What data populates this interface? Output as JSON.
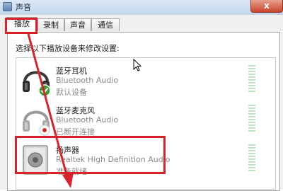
{
  "window": {
    "title": "声音",
    "close_glyph": "x"
  },
  "tabs": [
    {
      "label": "播放",
      "active": true
    },
    {
      "label": "录制",
      "active": false
    },
    {
      "label": "声音",
      "active": false
    },
    {
      "label": "通信",
      "active": false
    }
  ],
  "instruction": "选择以下播放设备来修改设置:",
  "devices": [
    {
      "name": "蓝牙耳机",
      "description": "Bluetooth Audio",
      "status": "默认设备",
      "icon": "headphones-icon",
      "badge": "green-check-badge"
    },
    {
      "name": "蓝牙麦克风",
      "description": "Bluetooth Audio",
      "status": "已断开连接",
      "icon": "headphones-icon",
      "badge": "red-disconnected-badge"
    },
    {
      "name": "扬声器",
      "description": "Realtek High Definition Audio",
      "status": "准备就绪",
      "icon": "speaker-icon",
      "badge": ""
    }
  ],
  "colors": {
    "highlight": "#d8232a",
    "meter": "#bfe3c0",
    "check": "#2da02b"
  }
}
